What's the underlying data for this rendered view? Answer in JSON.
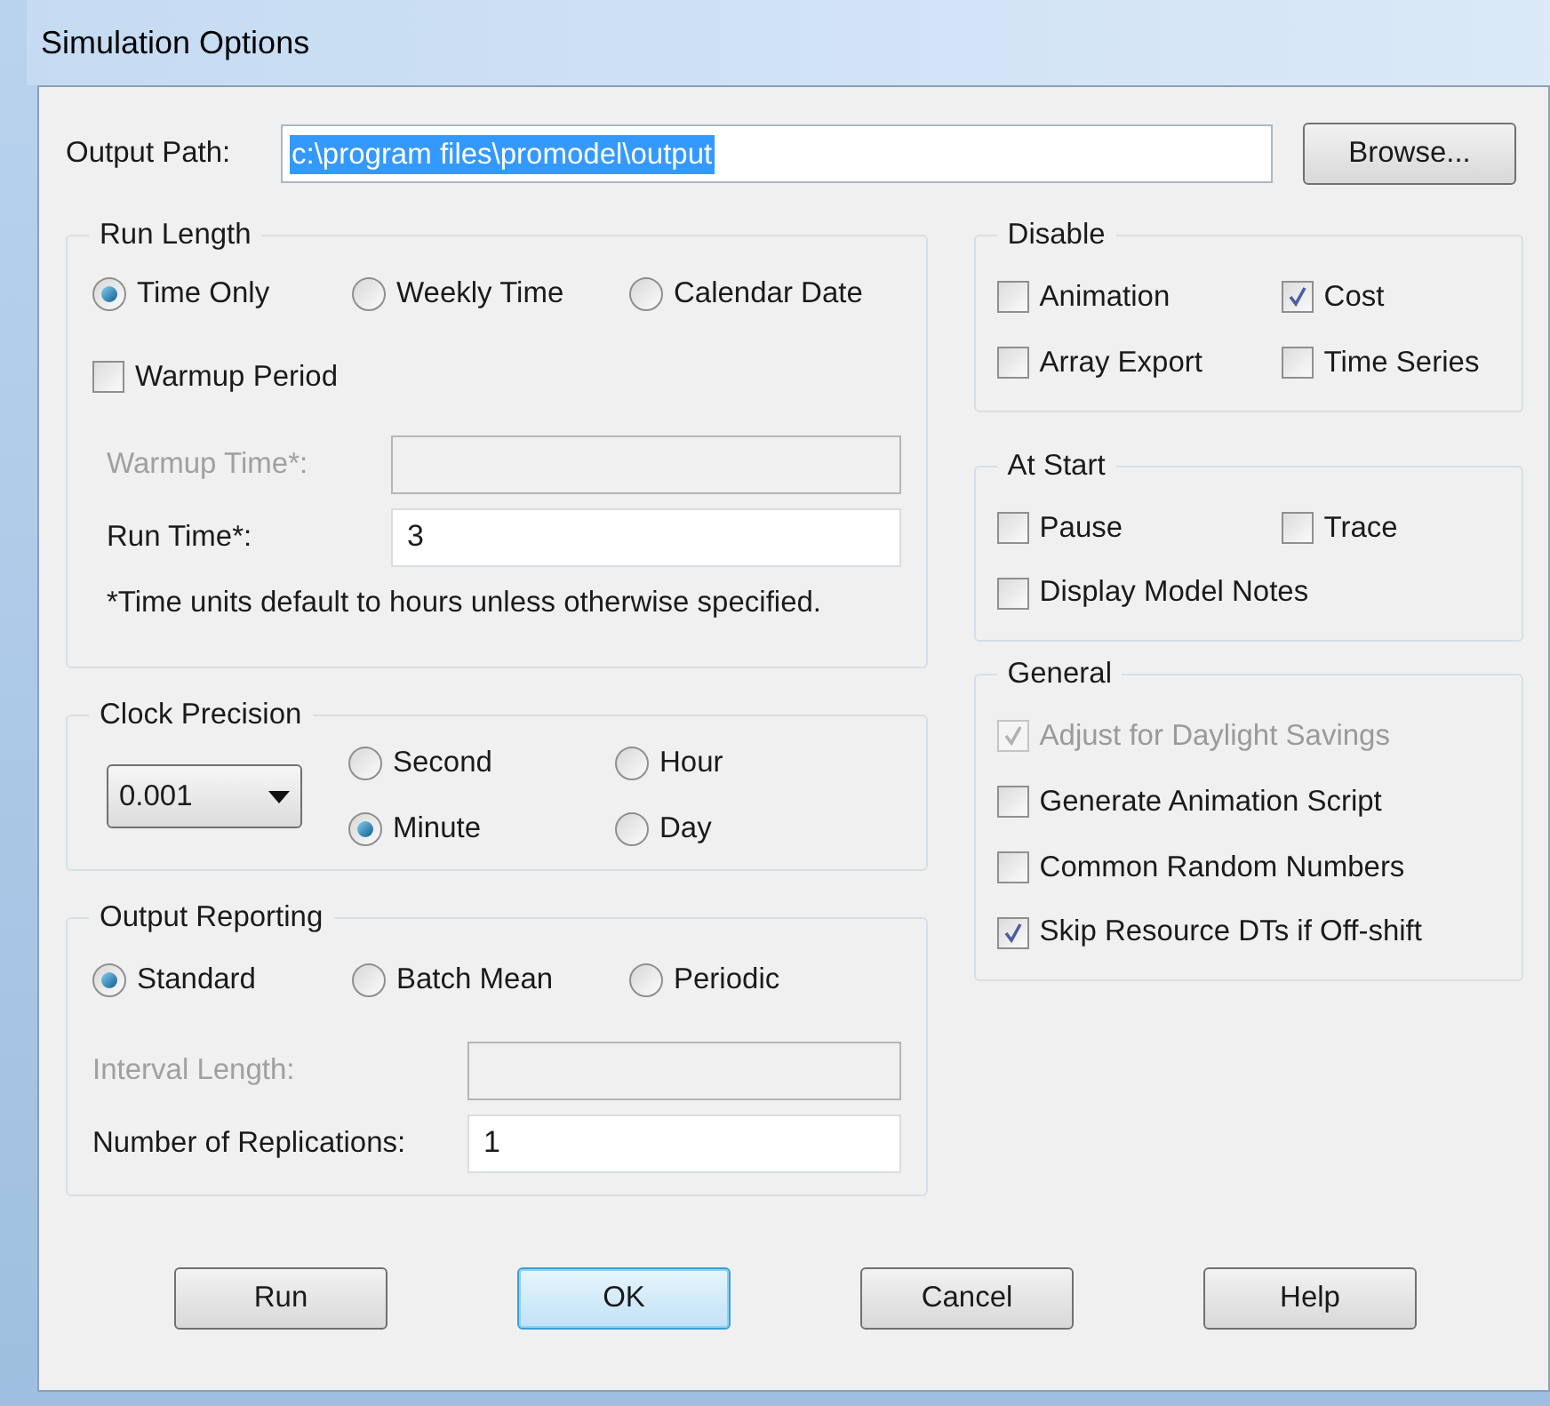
{
  "window": {
    "title": "Simulation Options"
  },
  "output_path": {
    "label": "Output Path:",
    "value": "c:\\program files\\promodel\\output",
    "selected": true
  },
  "browse_button": {
    "label": "Browse..."
  },
  "left_groups": [
    {
      "kind": "run_length",
      "title": "Run Length",
      "radio_rows": [
        [
          {
            "label": "Time Only",
            "selected": true
          },
          {
            "label": "Weekly Time",
            "selected": false
          },
          {
            "label": "Calendar Date",
            "selected": false
          }
        ]
      ],
      "checkbox": {
        "label": "Warmup Period",
        "checked": false
      },
      "fields": [
        {
          "label": "Warmup Time*:",
          "disabled": true
        },
        {
          "label": "Run Time*:",
          "value": "3",
          "disabled": false
        }
      ],
      "note": "*Time units default to hours unless otherwise specified."
    },
    {
      "kind": "clock",
      "title": "Clock Precision",
      "dropdown": {
        "value": "0.001"
      },
      "radio_rows": [
        [
          {
            "label": "Second",
            "selected": false
          },
          {
            "label": "Hour",
            "selected": false
          }
        ],
        [
          {
            "label": "Minute",
            "selected": true
          },
          {
            "label": "Day",
            "selected": false
          }
        ]
      ]
    },
    {
      "kind": "reporting",
      "title": "Output Reporting",
      "radio_rows": [
        [
          {
            "label": "Standard",
            "selected": true
          },
          {
            "label": "Batch Mean",
            "selected": false
          },
          {
            "label": "Periodic",
            "selected": false
          }
        ]
      ],
      "fields": [
        {
          "label": "Interval Length:",
          "disabled": true
        },
        {
          "label": "Number of Replications:",
          "value": "1",
          "disabled": false
        }
      ]
    }
  ],
  "right_groups": [
    {
      "title": "Disable",
      "rows": [
        [
          {
            "label": "Animation",
            "checked": false,
            "disabled": false
          },
          {
            "label": "Cost",
            "checked": true,
            "disabled": false
          }
        ],
        [
          {
            "label": "Array Export",
            "checked": false,
            "disabled": false
          },
          {
            "label": "Time Series",
            "checked": false,
            "disabled": false
          }
        ]
      ]
    },
    {
      "title": "At Start",
      "rows": [
        [
          {
            "label": "Pause",
            "checked": false,
            "disabled": false
          },
          {
            "label": "Trace",
            "checked": false,
            "disabled": false
          }
        ],
        [
          {
            "label": "Display Model Notes",
            "checked": false,
            "disabled": false
          }
        ]
      ]
    },
    {
      "title": "General",
      "rows": [
        [
          {
            "label": "Adjust for Daylight Savings",
            "checked": true,
            "disabled": true
          }
        ],
        [
          {
            "label": "Generate Animation Script",
            "checked": false,
            "disabled": false
          }
        ],
        [
          {
            "label": "Common Random Numbers",
            "checked": false,
            "disabled": false
          }
        ],
        [
          {
            "label": "Skip Resource DTs if Off-shift",
            "checked": true,
            "disabled": false
          }
        ]
      ]
    }
  ],
  "buttons": [
    {
      "label": "Run",
      "default": false
    },
    {
      "label": "OK",
      "default": true
    },
    {
      "label": "Cancel",
      "default": false
    },
    {
      "label": "Help",
      "default": false
    }
  ]
}
